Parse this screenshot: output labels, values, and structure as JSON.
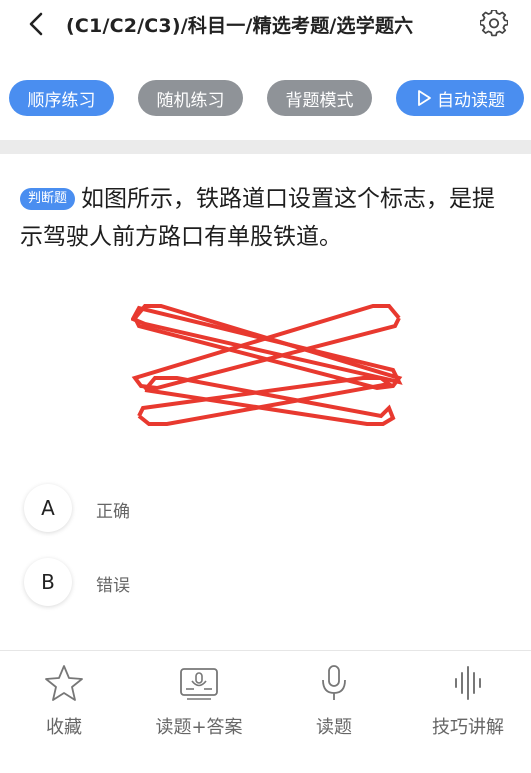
{
  "header": {
    "title": "(C1/C2/C3)/科目一/精选考题/选学题六"
  },
  "modes": [
    {
      "label": "顺序练习",
      "style": "active"
    },
    {
      "label": "随机练习",
      "style": "inactive"
    },
    {
      "label": "背题模式",
      "style": "inactive"
    },
    {
      "label": "自动读题",
      "style": "active"
    }
  ],
  "question": {
    "type": "判断题",
    "text": "如图所示，铁路道口设置这个标志，是提示驾驶人前方路口有单股铁道。"
  },
  "options": [
    {
      "letter": "A",
      "text": "正确"
    },
    {
      "letter": "B",
      "text": "错误"
    }
  ],
  "toolbar": [
    {
      "label": "收藏",
      "icon": "star-icon"
    },
    {
      "label": "读题+答案",
      "icon": "read-answer-icon"
    },
    {
      "label": "读题",
      "icon": "microphone-icon"
    },
    {
      "label": "技巧讲解",
      "icon": "sound-wave-icon"
    }
  ],
  "colors": {
    "accent": "#4a8ef0",
    "chip_inactive": "#8f9398",
    "sign_red": "#e8392f"
  }
}
